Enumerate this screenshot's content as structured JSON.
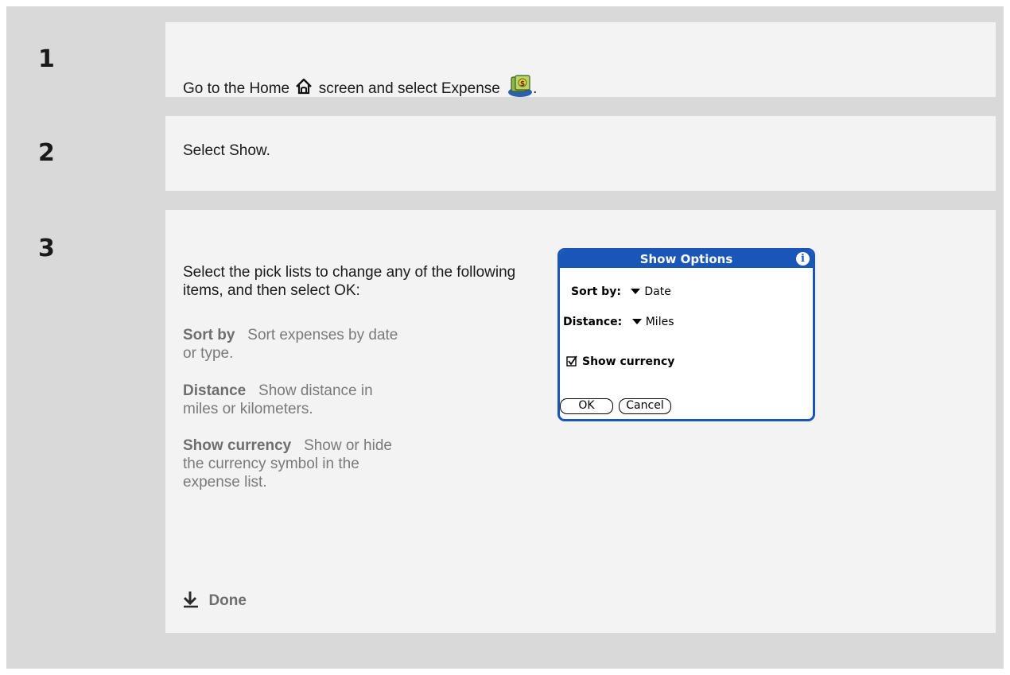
{
  "steps": [
    {
      "number": "1",
      "text_before": "Go to the Home",
      "text_middle": "screen and select Expense",
      "text_after": "."
    },
    {
      "number": "2",
      "text": "Select Show."
    },
    {
      "number": "3",
      "intro": "Select the pick lists to change any of the following items, and then select OK:",
      "items": [
        {
          "term": "Sort by",
          "description": "Sort expenses by date or type."
        },
        {
          "term": "Distance",
          "description": "Show distance in miles or kilometers."
        },
        {
          "term": "Show currency",
          "description": "Show or hide the currency symbol in the expense list."
        }
      ],
      "done_label": "Done"
    }
  ],
  "dialog": {
    "title": "Show Options",
    "sort_label": "Sort by:",
    "sort_value": "Date",
    "distance_label": "Distance:",
    "distance_value": "Miles",
    "checkbox_label": "Show currency",
    "checkbox_checked": true,
    "ok_label": "OK",
    "cancel_label": "Cancel"
  },
  "icons": {
    "home": "home-icon",
    "expense": "expense-app-icon",
    "done": "arrow-down-icon",
    "info": "info-icon"
  },
  "colors": {
    "dialog_blue": "#1a56b8",
    "label_gray": "#6e6e6e"
  }
}
